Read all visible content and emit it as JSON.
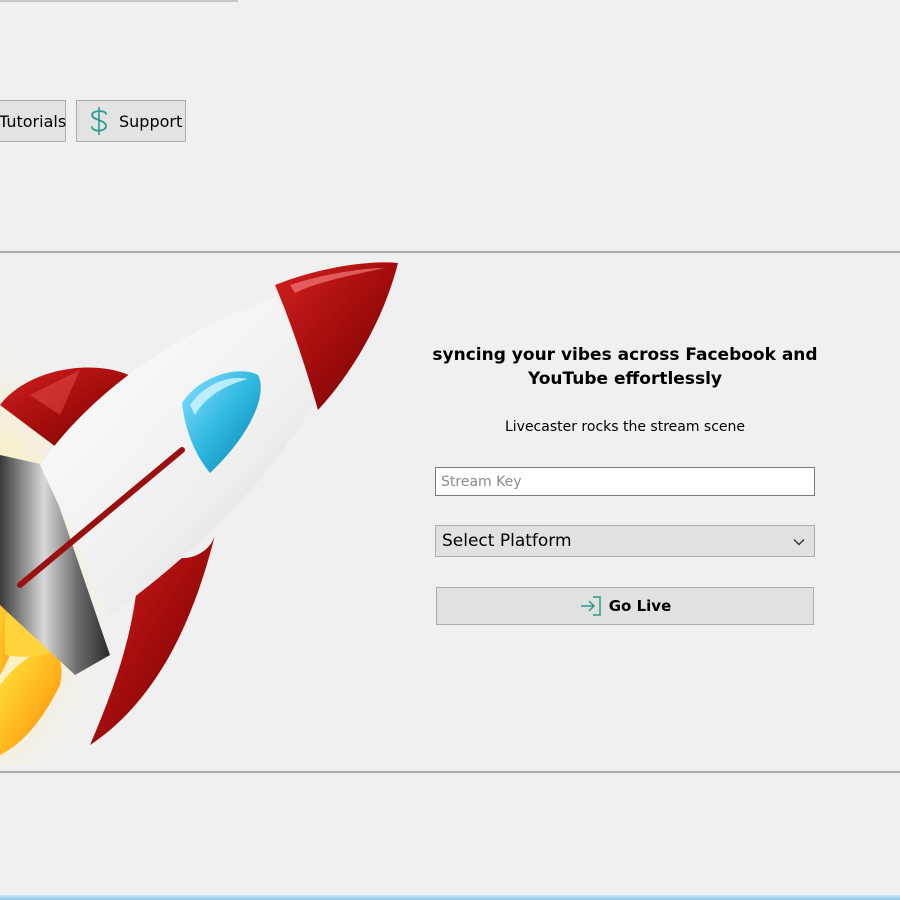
{
  "toolbar": {
    "tutorials_label": "Tutorials",
    "support_label": "Support",
    "support_icon": "dollar-icon"
  },
  "hero": {
    "image": "rocket-illustration"
  },
  "form": {
    "title": "syncing your vibes across Facebook and YouTube effortlessly",
    "subtitle": "Livecaster rocks the stream scene",
    "stream_key": {
      "value": "",
      "placeholder": "Stream Key"
    },
    "platform": {
      "selected": "Select Platform"
    },
    "go_live_label": "Go Live",
    "go_live_icon": "sign-in-icon"
  },
  "colors": {
    "background": "#f0f0f0",
    "button_bg": "#e1e1e1",
    "icon_accent": "#2b9c8c",
    "rocket_red": "#a80f0f",
    "rocket_window": "#2fb8e0"
  }
}
